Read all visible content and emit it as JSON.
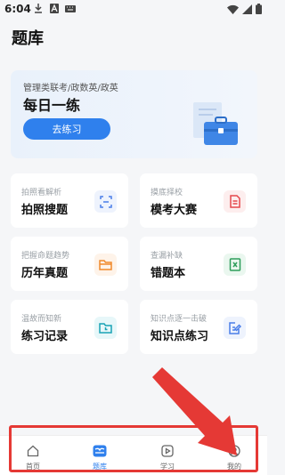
{
  "status": {
    "time": "6:04"
  },
  "page": {
    "title": "题库"
  },
  "banner": {
    "subtitle": "管理类联考/政数英/政英",
    "title": "每日一练",
    "button": "去练习"
  },
  "cards": [
    {
      "hint": "拍照看解析",
      "name": "拍照搜题",
      "icon": "scan-icon",
      "color": "#4a7ee8",
      "bg": "#eef3fd"
    },
    {
      "hint": "摸底择校",
      "name": "模考大赛",
      "icon": "document-icon",
      "color": "#e5484d",
      "bg": "#fdeeee"
    },
    {
      "hint": "把握命题趋势",
      "name": "历年真题",
      "icon": "folder-icon",
      "color": "#f08a2c",
      "bg": "#fef3e9"
    },
    {
      "hint": "查漏补缺",
      "name": "错题本",
      "icon": "error-book-icon",
      "color": "#2e9e5b",
      "bg": "#eaf7ef"
    },
    {
      "hint": "温故而知新",
      "name": "练习记录",
      "icon": "clock-folder-icon",
      "color": "#18a3b5",
      "bg": "#e7f7f9"
    },
    {
      "hint": "知识点逐一击破",
      "name": "知识点练习",
      "icon": "edit-icon",
      "color": "#4a7ee8",
      "bg": "#eef3fd"
    }
  ],
  "nav": [
    {
      "label": "首页",
      "icon": "home-icon",
      "active": false
    },
    {
      "label": "题库",
      "icon": "question-bank-icon",
      "active": true
    },
    {
      "label": "学习",
      "icon": "play-icon",
      "active": false
    },
    {
      "label": "我的",
      "icon": "profile-icon",
      "active": false
    }
  ],
  "colors": {
    "accent": "#2f80ed",
    "annotation": "#e53935"
  }
}
